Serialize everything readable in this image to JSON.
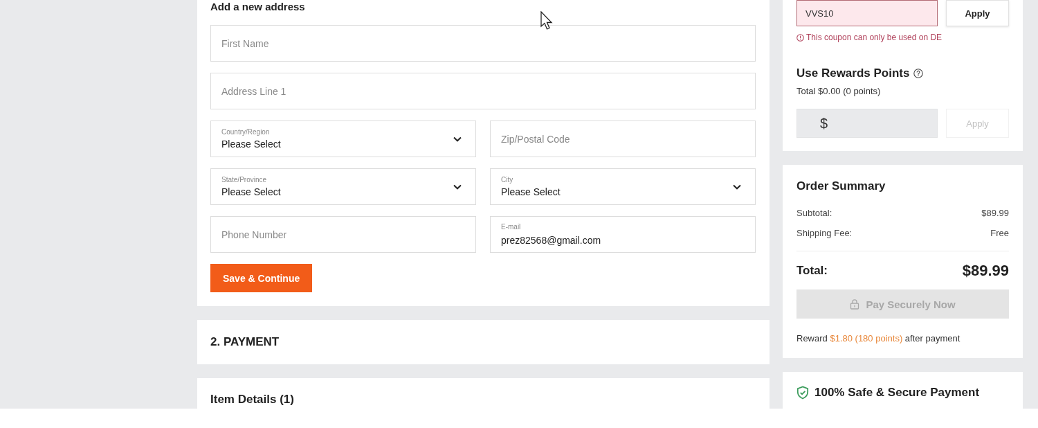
{
  "address_form": {
    "title": "Add a new address",
    "rows": [
      {
        "fields": [
          {
            "kind": "text",
            "placeholder": "First Name"
          }
        ]
      },
      {
        "fields": [
          {
            "kind": "text",
            "placeholder": "Address Line 1"
          }
        ]
      },
      {
        "fields": [
          {
            "kind": "select",
            "label": "Country/Region",
            "value": "Please Select"
          },
          {
            "kind": "text",
            "placeholder": "Zip/Postal Code"
          }
        ]
      },
      {
        "fields": [
          {
            "kind": "select",
            "label": "State/Province",
            "value": "Please Select"
          },
          {
            "kind": "select",
            "label": "City",
            "value": "Please Select"
          }
        ]
      },
      {
        "fields": [
          {
            "kind": "text",
            "placeholder": "Phone Number"
          },
          {
            "kind": "text",
            "label": "E-mail",
            "value": "prez82568@gmail.com"
          }
        ]
      }
    ],
    "submit_button": "Save & Continue"
  },
  "sections": [
    {
      "title": "2. PAYMENT"
    },
    {
      "title": "Item Details (1)"
    }
  ],
  "coupon": {
    "value": "VVS10",
    "invalid": true,
    "apply_button": {
      "label": "Apply",
      "disabled": false
    },
    "error": "This coupon can only be used on DE"
  },
  "rewards": {
    "title": "Use Rewards Points",
    "balance": "Total $0.00 (0 points)",
    "currency_symbol": "$",
    "apply_button": {
      "label": "Apply",
      "disabled": true
    }
  },
  "order_summary": {
    "title": "Order Summary",
    "lines": [
      {
        "label": "Subtotal:",
        "value": "$89.99"
      },
      {
        "label": "Shipping Fee:",
        "value": "Free"
      }
    ],
    "total": {
      "label": "Total:",
      "value": "$89.99"
    },
    "pay_button": {
      "label": "Pay Securely Now",
      "disabled": true
    },
    "reward_note": {
      "before": "Reward",
      "highlight": "$1.80 (180 points)",
      "after": "after payment"
    }
  },
  "security": {
    "title": "100% Safe & Secure Payment"
  }
}
